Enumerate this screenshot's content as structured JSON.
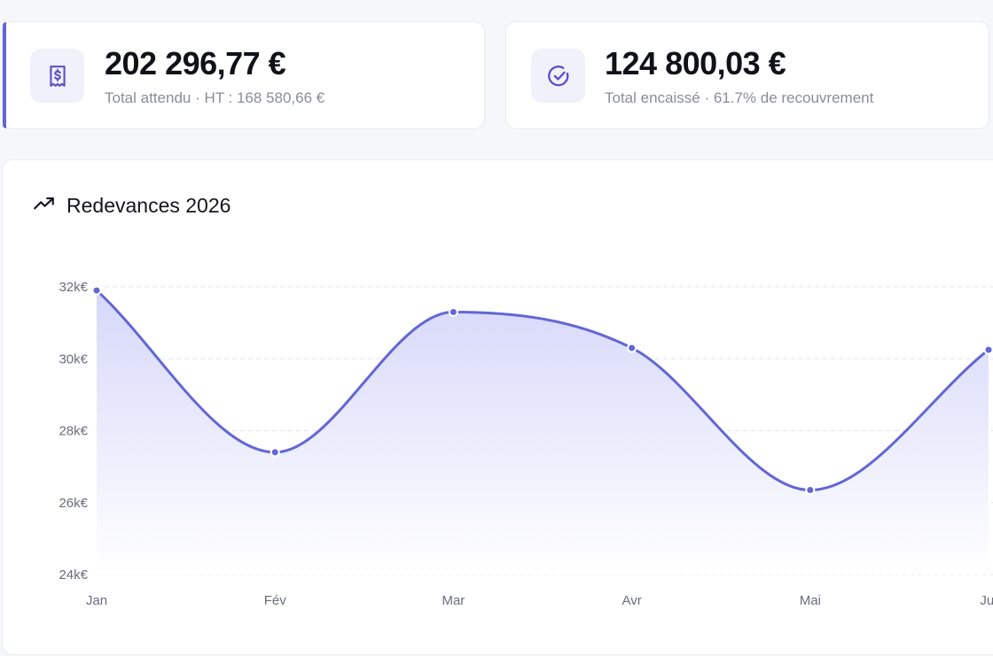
{
  "kpis": [
    {
      "value": "202 296,77 €",
      "subtitle": "Total attendu · HT : 168 580,66 €",
      "icon": "receipt-dollar-icon"
    },
    {
      "value": "124 800,03 €",
      "subtitle": "Total encaissé · 61.7% de recouvrement",
      "icon": "check-circle-icon"
    }
  ],
  "chart_card": {
    "title": "Redevances 2026",
    "icon": "trending-up-icon"
  },
  "colors": {
    "accent": "#6366d4",
    "line": "#6366d4",
    "area_top": "#d6d8f9",
    "grid": "#e4e6ee"
  },
  "chart_data": {
    "type": "area",
    "title": "Redevances 2026",
    "categories": [
      "Jan",
      "Fév",
      "Mar",
      "Avr",
      "Mai",
      "Jui"
    ],
    "series": [
      {
        "values": [
          31900,
          27400,
          31300,
          30300,
          26350,
          30250
        ]
      }
    ],
    "ylim": [
      24000,
      32000
    ],
    "yticks": [
      32000,
      30000,
      28000,
      26000,
      24000
    ],
    "ytick_labels": [
      "32k€",
      "30k€",
      "28k€",
      "26k€",
      "24k€"
    ],
    "grid": true,
    "legend": "none"
  }
}
